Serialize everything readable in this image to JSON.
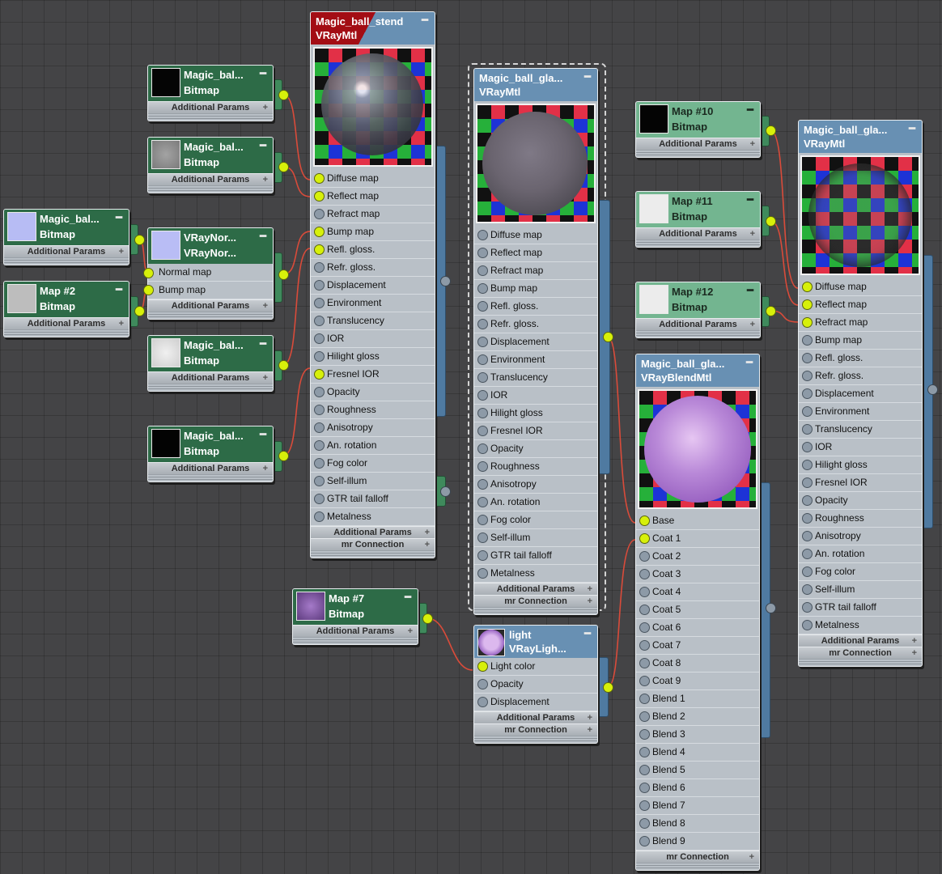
{
  "colors": {
    "wire": "#d94b3a",
    "port_active": "#d7f00a",
    "material_header": "#6890b3",
    "map_header": "#2d6b47"
  },
  "rollouts": {
    "additional": "Additional Params",
    "mr": "mr Connection"
  },
  "slots_vray": [
    "Diffuse map",
    "Reflect map",
    "Refract map",
    "Bump map",
    "Refl. gloss.",
    "Refr. gloss.",
    "Displacement",
    "Environment",
    "Translucency",
    "IOR",
    "Hilight gloss",
    "Fresnel IOR",
    "Opacity",
    "Roughness",
    "Anisotropy",
    "An. rotation",
    "Fog color",
    "Self-illum",
    "GTR tail falloff",
    "Metalness"
  ],
  "mat_stend": {
    "title": "Magic_ball_stend",
    "type": "VRayMtl"
  },
  "mat_glass": {
    "title": "Magic_ball_gla...",
    "type": "VRayMtl"
  },
  "mat_right": {
    "title": "Magic_ball_gla...",
    "type": "VRayMtl"
  },
  "blend": {
    "title": "Magic_ball_gla...",
    "type": "VRayBlendMtl",
    "slots": [
      "Base",
      "Coat 1",
      "Coat 2",
      "Coat 3",
      "Coat 4",
      "Coat 5",
      "Coat 6",
      "Coat 7",
      "Coat 8",
      "Coat 9",
      "Blend 1",
      "Blend 2",
      "Blend 3",
      "Blend 4",
      "Blend 5",
      "Blend 6",
      "Blend 7",
      "Blend 8",
      "Blend 9"
    ]
  },
  "light": {
    "title": "light",
    "type": "VRayLigh...",
    "slots": [
      "Light color",
      "Opacity",
      "Displacement"
    ]
  },
  "normal": {
    "title": "VRayNor...",
    "type": "VRayNor...",
    "slots": [
      "Normal map",
      "Bump map"
    ]
  },
  "maps": {
    "m1": {
      "title": "Magic_bal...",
      "type": "Bitmap"
    },
    "m2": {
      "title": "Magic_bal...",
      "type": "Bitmap"
    },
    "m3": {
      "title": "Magic_bal...",
      "type": "Bitmap"
    },
    "m4": {
      "title": "Magic_bal...",
      "type": "Bitmap"
    },
    "m5": {
      "title": "Magic_bal...",
      "type": "Bitmap"
    },
    "m6": {
      "title": "Magic_bal...",
      "type": "Bitmap"
    },
    "map2": {
      "title": "Map #2",
      "type": "Bitmap"
    },
    "map7": {
      "title": "Map #7",
      "type": "Bitmap"
    },
    "map10": {
      "title": "Map #10",
      "type": "Bitmap"
    },
    "map11": {
      "title": "Map #11",
      "type": "Bitmap"
    },
    "map12": {
      "title": "Map #12",
      "type": "Bitmap"
    }
  }
}
